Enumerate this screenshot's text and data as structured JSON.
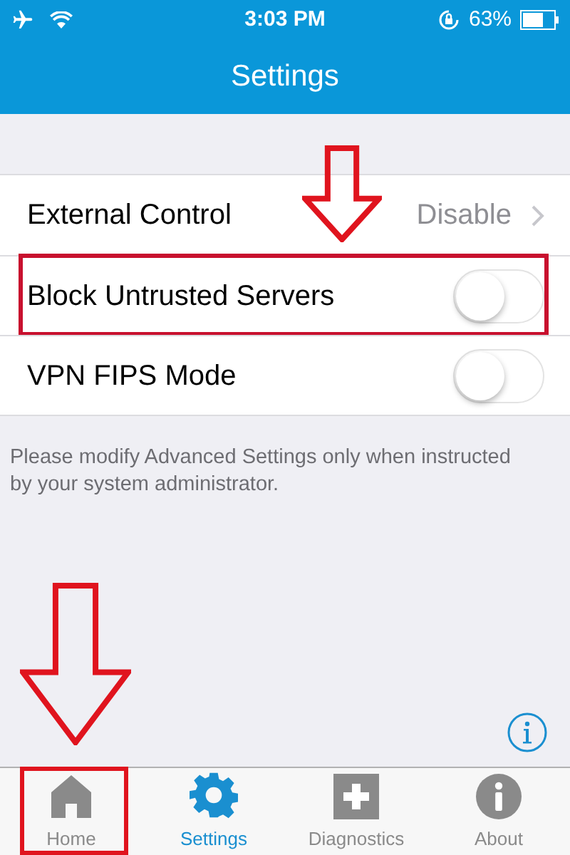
{
  "status_bar": {
    "time": "3:03 PM",
    "battery": "63%"
  },
  "header": {
    "title": "Settings"
  },
  "rows": [
    {
      "kind": "link",
      "label": "External Control",
      "value": "Disable",
      "highlighted": false
    },
    {
      "kind": "toggle",
      "label": "Block Untrusted Servers",
      "on": false,
      "highlighted": true
    },
    {
      "kind": "toggle",
      "label": "VPN FIPS Mode",
      "on": false,
      "highlighted": false
    }
  ],
  "note": "Please modify Advanced Settings only when instructed by your system administrator.",
  "tabs": [
    {
      "kind": "home",
      "label": "Home",
      "selected": false,
      "highlighted": true
    },
    {
      "kind": "settings",
      "label": "Settings",
      "selected": true,
      "highlighted": false
    },
    {
      "kind": "diagnostics",
      "label": "Diagnostics",
      "selected": false,
      "highlighted": false
    },
    {
      "kind": "about",
      "label": "About",
      "selected": false,
      "highlighted": false
    }
  ]
}
